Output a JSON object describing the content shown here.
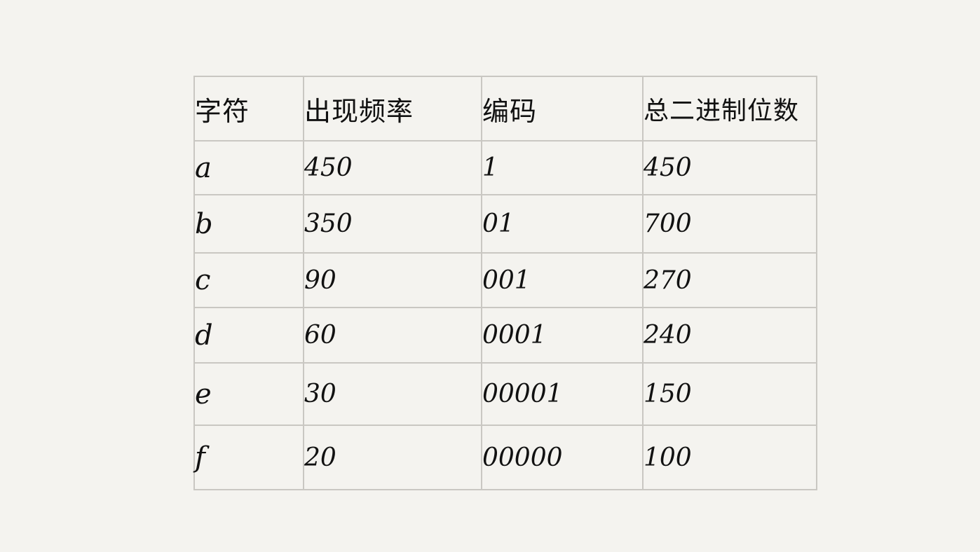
{
  "table": {
    "headers": [
      "字符",
      "出现频率",
      "编码",
      "总二进制位数"
    ],
    "rows": [
      {
        "char": "a",
        "freq": "450",
        "code": "1",
        "bits": "450"
      },
      {
        "char": "b",
        "freq": "350",
        "code": "01",
        "bits": "700"
      },
      {
        "char": "c",
        "freq": "90",
        "code": "001",
        "bits": "270"
      },
      {
        "char": "d",
        "freq": "60",
        "code": "0001",
        "bits": "240"
      },
      {
        "char": "e",
        "freq": "30",
        "code": "00001",
        "bits": "150"
      },
      {
        "char": "f",
        "freq": "20",
        "code": "00000",
        "bits": "100"
      }
    ]
  },
  "colors": {
    "background": "#f4f3ef",
    "grid": "#c9c7c2",
    "ink": "#111111"
  }
}
